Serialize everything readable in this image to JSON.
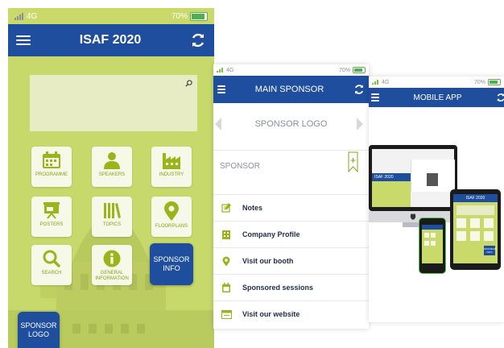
{
  "phone1": {
    "status": {
      "network": "4G",
      "battery": "70%"
    },
    "title": "ISAF 2020",
    "tiles": [
      {
        "label": "PROGRAMME",
        "icon": "calendar-icon"
      },
      {
        "label": "SPEAKERS",
        "icon": "person-icon"
      },
      {
        "label": "INDUSTRY",
        "icon": "factory-icon"
      },
      {
        "label": "POSTERS",
        "icon": "presentation-icon"
      },
      {
        "label": "TOPICS",
        "icon": "books-icon"
      },
      {
        "label": "FLOORPLANS",
        "icon": "map-pin-icon"
      },
      {
        "label": "SEARCH",
        "icon": "magnifier-icon"
      },
      {
        "label": "GENERAL INFORMATION",
        "icon": "info-icon"
      }
    ],
    "sponsor_info": {
      "line1": "SPONSOR",
      "line2": "INFO"
    },
    "sponsor_logo": {
      "line1": "SPONSOR",
      "line2": "LOGO"
    },
    "colors": {
      "brand_blue": "#1f4e9e",
      "lime": "#c9d96a",
      "tile_text": "#8aa01a"
    }
  },
  "phone2": {
    "status": {
      "network": "4G",
      "battery": "70%"
    },
    "title": "MAIN SPONSOR",
    "logo_placeholder": "SPONSOR LOGO",
    "sponsor_name": "SPONSOR",
    "menu": [
      {
        "label": "Notes",
        "icon": "notes-icon"
      },
      {
        "label": "Company Profile",
        "icon": "building-icon"
      },
      {
        "label": "Visit our booth",
        "icon": "map-pin-icon"
      },
      {
        "label": "Sponsored sessions",
        "icon": "calendar-icon"
      },
      {
        "label": "Visit our website",
        "icon": "browser-icon"
      }
    ]
  },
  "phone3": {
    "status": {
      "network": "4G",
      "battery": "70%"
    },
    "title": "MOBILE APP",
    "devices": {
      "laptop_title": "ISAF 2020",
      "tablet_title": "ISAF 2020",
      "sponsor_label": "SPONSOR INFO"
    }
  }
}
